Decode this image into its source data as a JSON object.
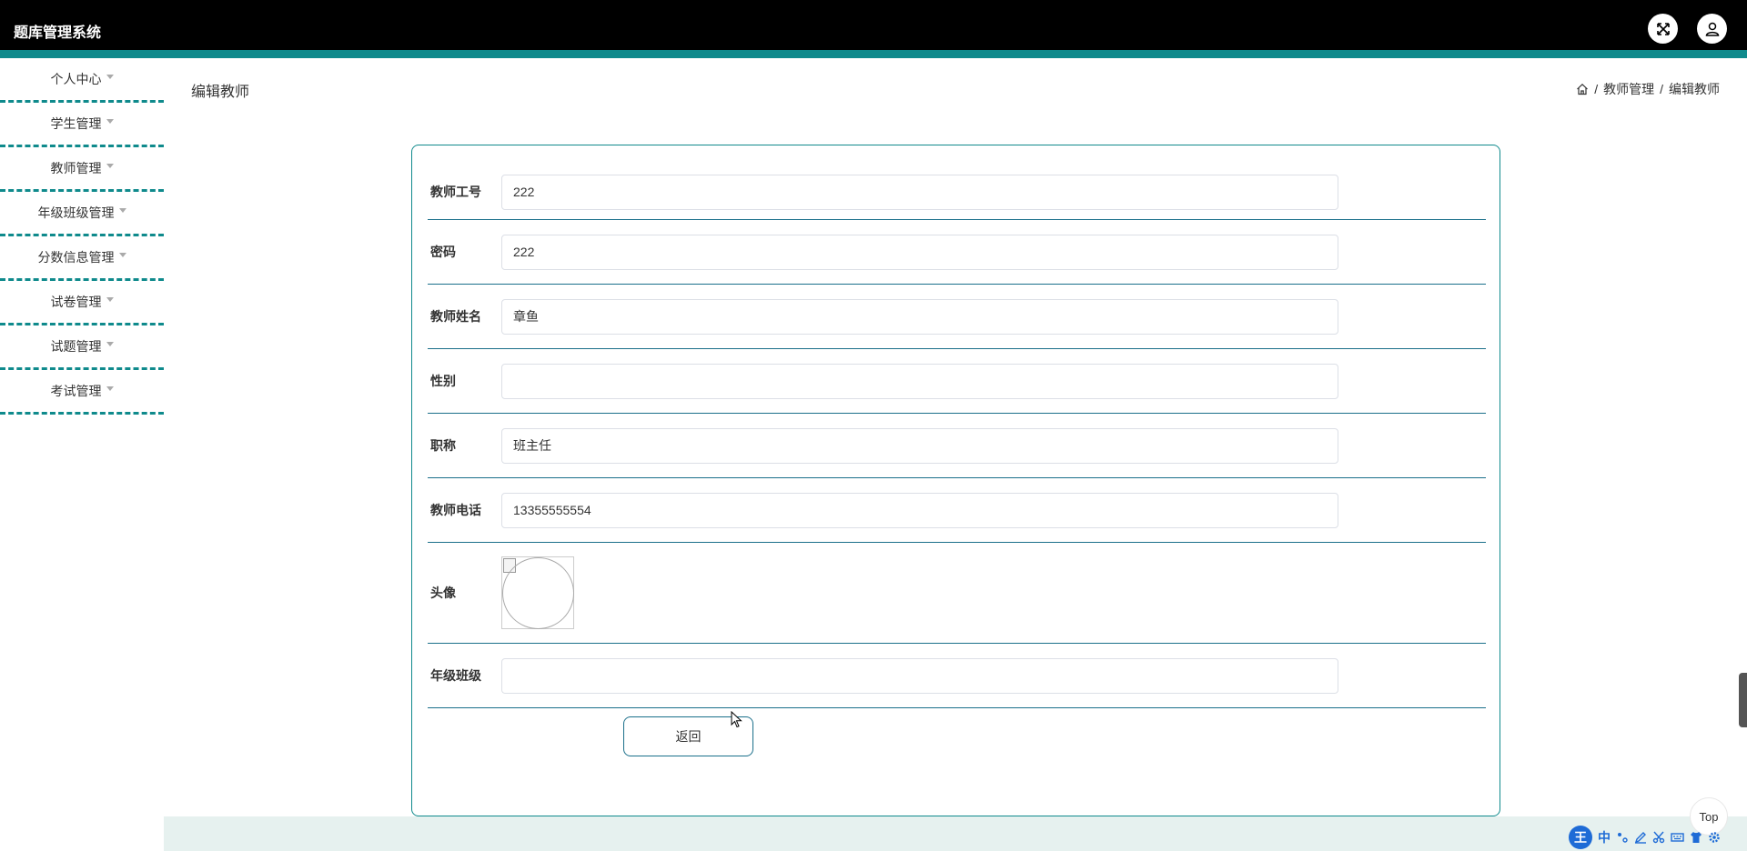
{
  "header": {
    "app_title": "题库管理系统",
    "fullscreen_icon": "fullscreen-icon",
    "user_icon": "user-icon"
  },
  "sidebar": {
    "items": [
      {
        "label": "个人中心"
      },
      {
        "label": "学生管理"
      },
      {
        "label": "教师管理"
      },
      {
        "label": "年级班级管理"
      },
      {
        "label": "分数信息管理"
      },
      {
        "label": "试卷管理"
      },
      {
        "label": "试题管理"
      },
      {
        "label": "考试管理"
      }
    ]
  },
  "main": {
    "page_title": "编辑教师",
    "breadcrumb": {
      "home_icon": "home-icon",
      "separator": "/",
      "items": [
        "教师管理",
        "编辑教师"
      ]
    },
    "form": {
      "fields": [
        {
          "label": "教师工号",
          "value": "222"
        },
        {
          "label": "密码",
          "value": "222"
        },
        {
          "label": "教师姓名",
          "value": "章鱼"
        },
        {
          "label": "性别",
          "value": ""
        },
        {
          "label": "职称",
          "value": "班主任"
        },
        {
          "label": "教师电话",
          "value": "13355555554"
        },
        {
          "label": "头像",
          "type": "image"
        },
        {
          "label": "年级班级",
          "value": ""
        }
      ],
      "back_label": "返回"
    }
  },
  "widgets": {
    "top_label": "Top",
    "ime": {
      "logo": "王",
      "lang": "中",
      "icons": [
        "punctuation-icon",
        "pen-icon",
        "scissors-icon",
        "keyboard-icon",
        "shirt-icon",
        "settings-icon"
      ]
    }
  },
  "colors": {
    "accent": "#0f8a8c",
    "header_bg": "#000000",
    "row_border": "#1a6f8a",
    "footer_bg": "#e6f1ef"
  }
}
